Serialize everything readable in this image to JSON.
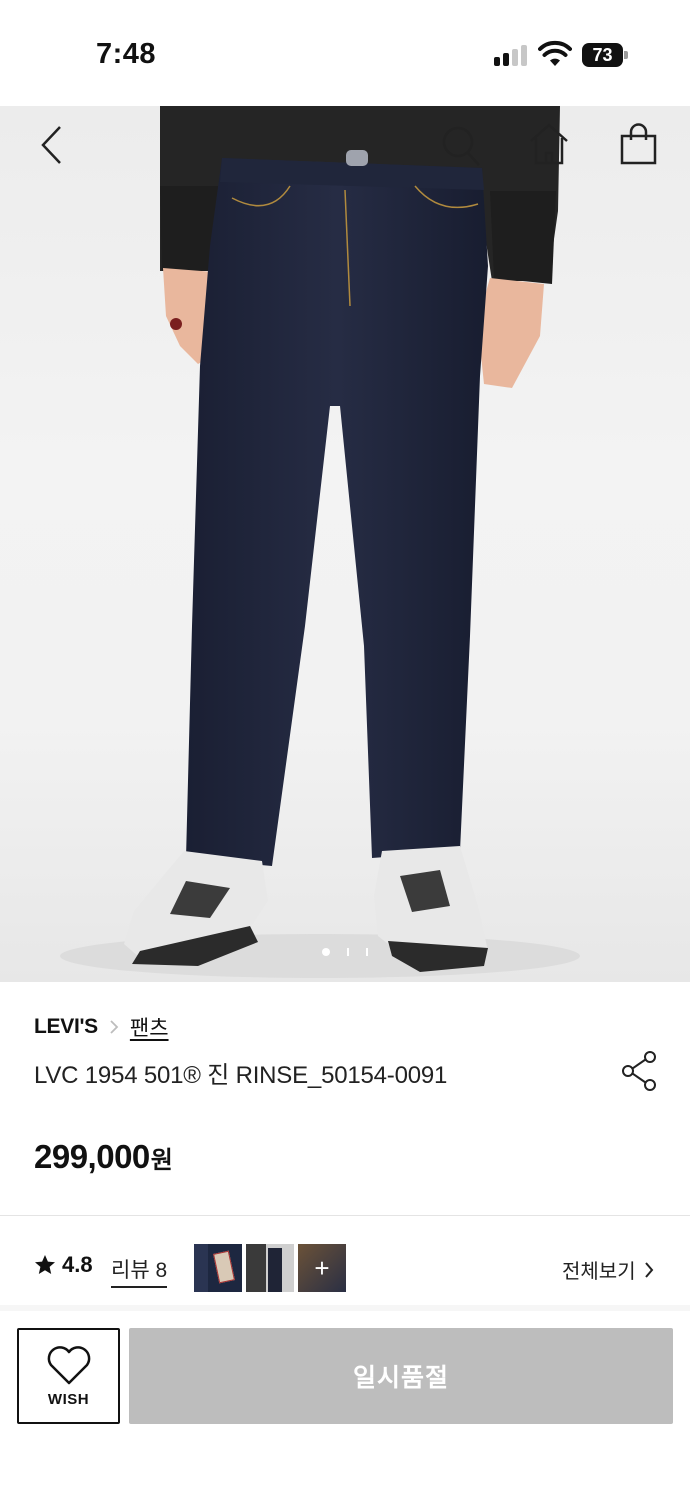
{
  "status_bar": {
    "time": "7:48",
    "battery": "73"
  },
  "hero": {
    "nav_icons": [
      "back-icon",
      "search-icon",
      "home-icon",
      "shopping-bag-icon"
    ],
    "carousel": {
      "total": 3,
      "active": 1
    }
  },
  "product": {
    "brand": "LEVI'S",
    "category": "팬츠",
    "name": "LVC 1954 501® 진 RINSE_50154-0091",
    "price": "299,000",
    "price_unit": "원"
  },
  "reviews": {
    "rating": "4.8",
    "review_label": "리뷰 8",
    "thumb_more": "+",
    "view_all": "전체보기"
  },
  "actions": {
    "wish_label": "WISH",
    "soldout_label": "일시품절"
  },
  "colors": {
    "soldout_bg": "#bdbdbd",
    "text": "#111111"
  }
}
